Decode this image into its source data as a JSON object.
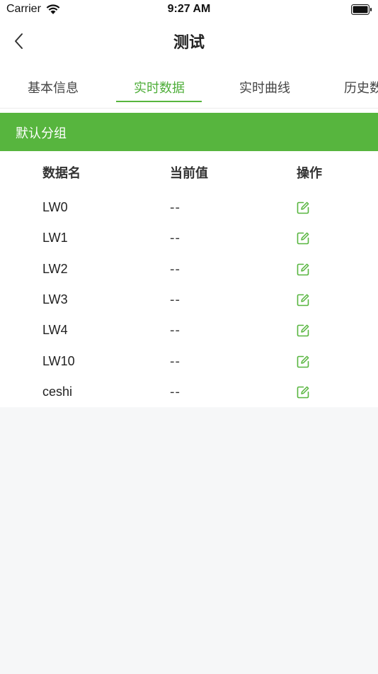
{
  "status_bar": {
    "carrier": "Carrier",
    "time": "9:27 AM"
  },
  "nav": {
    "title": "测试",
    "back_icon": "chevron-left-icon"
  },
  "tabs": [
    {
      "label": "基本信息",
      "active": false
    },
    {
      "label": "实时数据",
      "active": true
    },
    {
      "label": "实时曲线",
      "active": false
    },
    {
      "label": "历史数据",
      "active": false
    }
  ],
  "group": {
    "label": "默认分组"
  },
  "table": {
    "headers": [
      "数据名",
      "当前值",
      "操作"
    ],
    "rows": [
      {
        "name": "LW0",
        "value": "--"
      },
      {
        "name": "LW1",
        "value": "--"
      },
      {
        "name": "LW2",
        "value": "--"
      },
      {
        "name": "LW3",
        "value": "--"
      },
      {
        "name": "LW4",
        "value": "--"
      },
      {
        "name": "LW10",
        "value": "--"
      },
      {
        "name": "ceshi",
        "value": "--"
      }
    ],
    "action_icon": "edit-icon"
  },
  "colors": {
    "accent": "#57b53e",
    "background": "#f6f7f8"
  }
}
